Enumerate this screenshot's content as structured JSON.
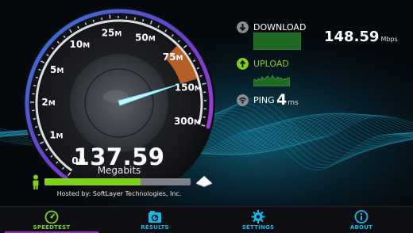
{
  "speedometer": {
    "scale_labels": [
      "0M",
      "1M",
      "2M",
      "5M",
      "10M",
      "25M",
      "50M",
      "75M",
      "150M",
      "300M"
    ],
    "current_value": "137.59",
    "current_unit": "Megabits"
  },
  "progress": {
    "fraction": 0.66
  },
  "hosted_by": "Hosted by: SoftLayer Technologies, Inc.",
  "results": {
    "download": {
      "label": "DOWNLOAD",
      "value": "148.59",
      "unit": "Mbps"
    },
    "upload": {
      "label": "UPLOAD"
    },
    "ping": {
      "label": "PING",
      "value": "4",
      "unit": "ms"
    }
  },
  "tabs": [
    {
      "label": "SPEEDTEST",
      "icon": "speedtest-icon",
      "active": true
    },
    {
      "label": "RESULTS",
      "icon": "results-icon",
      "active": false
    },
    {
      "label": "SETTINGS",
      "icon": "settings-icon",
      "active": false
    },
    {
      "label": "ABOUT",
      "icon": "about-icon",
      "active": false
    }
  ],
  "colors": {
    "accent_green": "#7fd11b",
    "accent_cyan": "#16b8e8",
    "accent_purple": "#9b2cc0",
    "needle_orange": "#e8782a"
  }
}
